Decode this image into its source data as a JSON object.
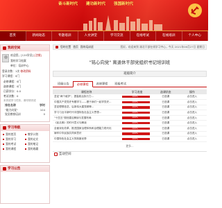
{
  "banner": {
    "slogans": [
      "奋斗新时代",
      "建功新时代",
      "强国新时代"
    ]
  },
  "nav": {
    "items": [
      "首页",
      "新闻动态",
      "专题培训",
      "人文讲堂",
      "学习交流",
      "在线考试",
      "在线培训",
      "个人中心"
    ],
    "active_index": 0
  },
  "sidebar": {
    "user_panel_title": "我的空间",
    "user_lines": [
      "欢迎您，[120学员]",
      "我的学习档案",
      "单位：培训中心",
      "登录次数：1次",
      "学习课程：0门"
    ],
    "user_actions": [
      "[注销]",
      "修改资料"
    ],
    "stats": [
      "必修课程：0门",
      "选修课程：0门",
      "已获学分：0.0",
      "考试次数：0"
    ],
    "note": "未完成学习任务，请尽快完成",
    "rank_headers": [
      "排名名称",
      "学时"
    ],
    "rank_rows": [
      {
        "name": "\"能力向党\"",
        "value": "104"
      },
      {
        "name": "党员教育培训",
        "value": "0"
      }
    ],
    "menu_title": "学习导航",
    "menu_items": [
      "我的首页",
      "教学计划",
      "我的学习",
      "我的论文",
      "我的考试",
      "我的笔记",
      "我的课程",
      "我的收藏"
    ],
    "news_title": "学习公告"
  },
  "main": {
    "breadcrumb": [
      "您的位置",
      "首页",
      "我的培训班"
    ],
    "welcome": "您好，欢迎来到 湖北干部在线学习中心，今天 2021年06月27日 星期日",
    "course_title": "\"铭心向党\" 离退休干部党组织书记培训班",
    "intro_label": "班级简介",
    "tabs": [
      "班级公告",
      "必修课程",
      "选修课程",
      "班级考试"
    ],
    "active_tab": 1,
    "table_headers": [
      "课程名称",
      "学习进度",
      "选课状态",
      "操作"
    ],
    "rows": [
      {
        "name": "坚定\"两个维护\"，提高政治执行力...",
        "progress": 100,
        "progress_label": "100%",
        "status": "已选课",
        "action": "点击进入"
      },
      {
        "name": "中国共产党党史专题学习——基于我们一起学党史...",
        "progress": 100,
        "progress_label": "100%",
        "status": "已选课",
        "action": "点击进入"
      },
      {
        "name": "坚定理想信念，弘扬伟大建党精神...",
        "progress": 100,
        "progress_label": "100%",
        "status": "已选课",
        "action": "点击进入"
      },
      {
        "name": "学习习近平新时代中国特色社会主义思想...",
        "progress": 100,
        "progress_label": "100%",
        "status": "已选课",
        "action": "点击进入"
      },
      {
        "name": "\"十四五\"规划建议解读与发展布局",
        "progress": 100,
        "progress_label": "100%",
        "status": "已选课",
        "action": "点击进入"
      },
      {
        "name": "《民法典》的时代意义与解读",
        "progress": 100,
        "progress_label": "100%",
        "status": "已选课",
        "action": "点击进入"
      },
      {
        "name": "全面深化改革，推进国家治理体系和治理能力现代化",
        "progress": 100,
        "progress_label": "100%",
        "status": "已选课",
        "action": "点击进入"
      },
      {
        "name": "铸牢中华民族共同体意识",
        "progress": 100,
        "progress_label": "100%",
        "status": "已选课",
        "action": "点击进入"
      },
      {
        "name": "中国特色社会主义的制度优势",
        "progress": 100,
        "progress_label": "100%",
        "status": "已选课",
        "action": "点击进入"
      }
    ],
    "more_label": "更多...",
    "interact_label": "互动空间"
  },
  "colors": {
    "primary_red": "#c60d0d",
    "dark_red": "#b00a0a",
    "slogan_yellow": "#ffe96b"
  }
}
